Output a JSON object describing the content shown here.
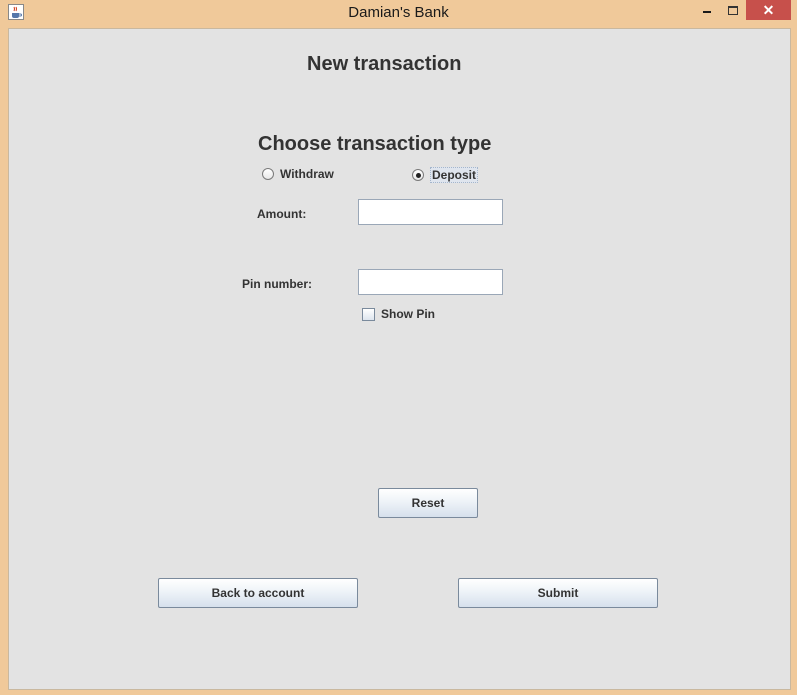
{
  "window": {
    "title": "Damian's Bank",
    "icon": "java-cup-icon",
    "controls": {
      "minimize": "minimize-icon",
      "maximize": "maximize-icon",
      "close": "✕"
    }
  },
  "form": {
    "heading": "New transaction",
    "subheading": "Choose transaction type",
    "transaction_types": [
      {
        "label": "Withdraw",
        "selected": false
      },
      {
        "label": "Deposit",
        "selected": true
      }
    ],
    "amount_label": "Amount:",
    "amount_value": "",
    "pin_label": "Pin number:",
    "pin_value": "",
    "show_pin_label": "Show Pin",
    "show_pin_checked": false
  },
  "buttons": {
    "reset": "Reset",
    "back": "Back to account",
    "submit": "Submit"
  },
  "colors": {
    "titlebar": "#f0c99a",
    "close": "#c7504b",
    "panel": "#e3e3e3"
  }
}
